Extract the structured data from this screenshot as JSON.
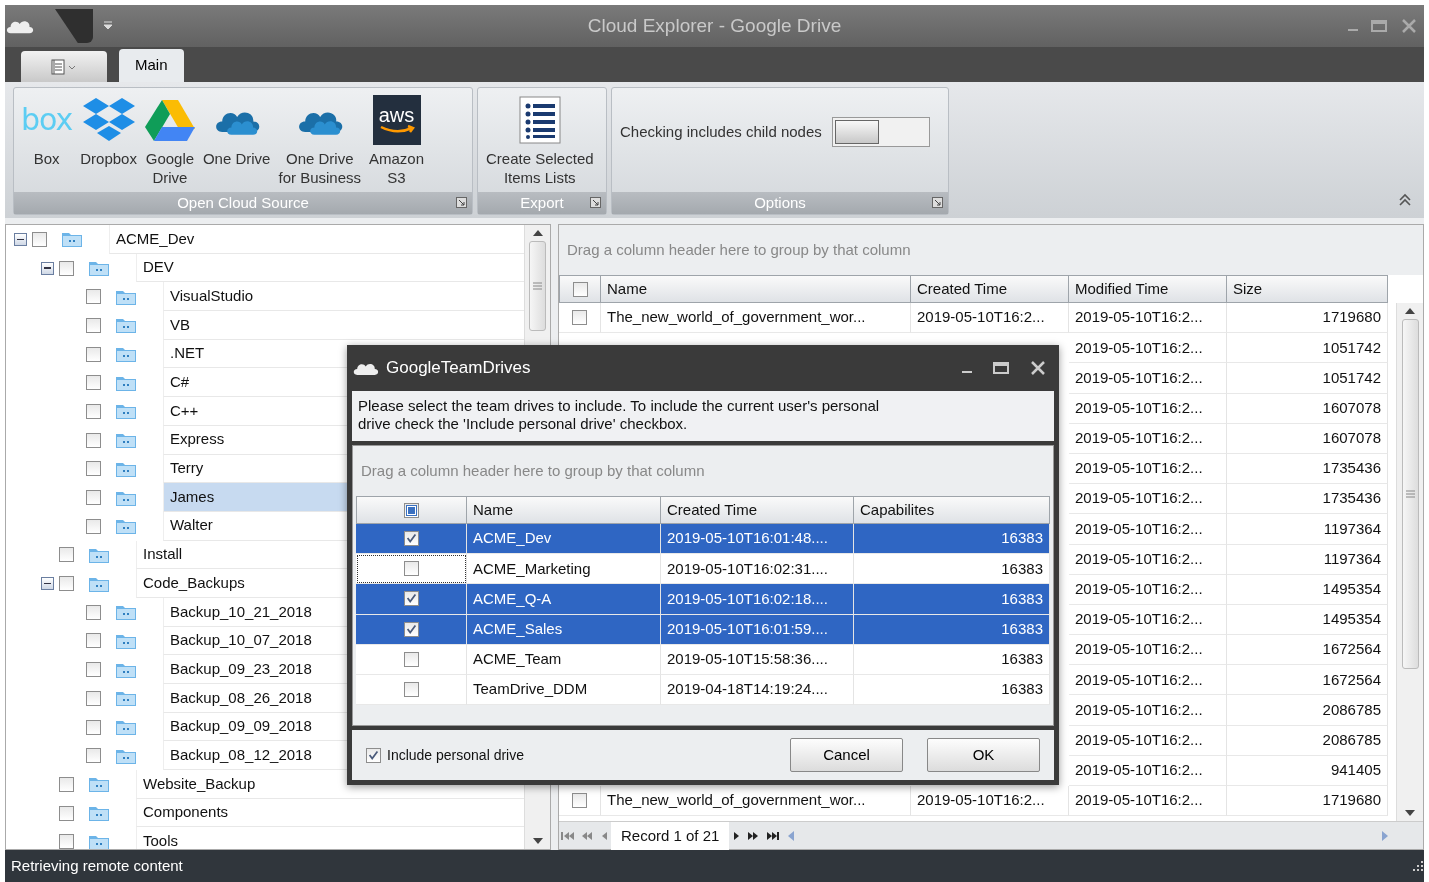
{
  "window": {
    "title": "Cloud Explorer - Google Drive"
  },
  "ribbon": {
    "tabs": [
      {
        "label": "Main",
        "selected": true
      }
    ],
    "groups": [
      {
        "label": "Open Cloud Source",
        "items": [
          {
            "kind": "box",
            "label": "Box",
            "logo_text": "box"
          },
          {
            "kind": "dropbox",
            "label": "Dropbox"
          },
          {
            "kind": "gdrive",
            "label": "Google\nDrive"
          },
          {
            "kind": "cloud",
            "label": "One Drive"
          },
          {
            "kind": "cloud",
            "label": "One Drive\nfor Business"
          },
          {
            "kind": "aws",
            "label": "Amazon\nS3",
            "logo_text": "aws"
          }
        ]
      },
      {
        "label": "Export",
        "items": [
          {
            "kind": "list",
            "label": "Create Selected\nItems Lists"
          }
        ]
      },
      {
        "label": "Options",
        "items": [
          {
            "kind": "toggle",
            "label": "Checking includes child nodes",
            "on": false
          }
        ]
      }
    ]
  },
  "tree": {
    "items": [
      {
        "label": "ACME_Dev",
        "checked": false,
        "selected": false,
        "expanded": true,
        "children": [
          {
            "label": "DEV",
            "checked": false,
            "selected": false,
            "expanded": true,
            "children": [
              {
                "label": "VisualStudio",
                "checked": false,
                "selected": false
              },
              {
                "label": "VB",
                "checked": false,
                "selected": false
              },
              {
                "label": ".NET",
                "checked": false,
                "selected": false
              },
              {
                "label": "C#",
                "checked": false,
                "selected": false
              },
              {
                "label": "C++",
                "checked": false,
                "selected": false
              },
              {
                "label": "Express",
                "checked": false,
                "selected": false
              },
              {
                "label": "Terry",
                "checked": false,
                "selected": false
              },
              {
                "label": "James",
                "checked": false,
                "selected": true
              },
              {
                "label": "Walter",
                "checked": false,
                "selected": false
              }
            ]
          },
          {
            "label": "Install",
            "checked": false,
            "selected": false
          },
          {
            "label": "Code_Backups",
            "checked": false,
            "selected": false,
            "expanded": true,
            "children": [
              {
                "label": "Backup_10_21_2018",
                "checked": false,
                "selected": false
              },
              {
                "label": "Backup_10_07_2018",
                "checked": false,
                "selected": false
              },
              {
                "label": "Backup_09_23_2018",
                "checked": false,
                "selected": false
              },
              {
                "label": "Backup_08_26_2018",
                "checked": false,
                "selected": false
              },
              {
                "label": "Backup_09_09_2018",
                "checked": false,
                "selected": false
              },
              {
                "label": "Backup_08_12_2018",
                "checked": false,
                "selected": false
              }
            ]
          },
          {
            "label": "Website_Backup",
            "checked": false,
            "selected": false
          },
          {
            "label": "Components",
            "checked": false,
            "selected": false
          },
          {
            "label": "Tools",
            "checked": false,
            "selected": false
          }
        ]
      }
    ]
  },
  "grid": {
    "group_hint": "Drag a column header here to group by that column",
    "header_checked": false,
    "columns": [
      "Name",
      "Created Time",
      "Modified Time",
      "Size"
    ],
    "rows": [
      {
        "checked": false,
        "name": "The_new_world_of_government_wor...",
        "created": "2019-05-10T16:2...",
        "modified": "2019-05-10T16:2...",
        "size": "1719680"
      },
      {
        "modified": "2019-05-10T16:2...",
        "size": "1051742"
      },
      {
        "modified": "2019-05-10T16:2...",
        "size": "1051742"
      },
      {
        "modified": "2019-05-10T16:2...",
        "size": "1607078"
      },
      {
        "modified": "2019-05-10T16:2...",
        "size": "1607078"
      },
      {
        "modified": "2019-05-10T16:2...",
        "size": "1735436"
      },
      {
        "modified": "2019-05-10T16:2...",
        "size": "1735436"
      },
      {
        "modified": "2019-05-10T16:2...",
        "size": "1197364"
      },
      {
        "modified": "2019-05-10T16:2...",
        "size": "1197364"
      },
      {
        "modified": "2019-05-10T16:2...",
        "size": "1495354"
      },
      {
        "modified": "2019-05-10T16:2...",
        "size": "1495354"
      },
      {
        "modified": "2019-05-10T16:2...",
        "size": "1672564"
      },
      {
        "modified": "2019-05-10T16:2...",
        "size": "1672564"
      },
      {
        "modified": "2019-05-10T16:2...",
        "size": "2086785"
      },
      {
        "modified": "2019-05-10T16:2...",
        "size": "2086785"
      },
      {
        "modified": "2019-05-10T16:2...",
        "size": "941405"
      },
      {
        "checked": false,
        "name": "The_new_world_of_government_wor...",
        "created": "2019-05-10T16:2...",
        "modified": "2019-05-10T16:2...",
        "size": "1719680"
      }
    ],
    "navigator": "Record 1 of 21"
  },
  "dialog": {
    "title": "GoogleTeamDrives",
    "message": "Please select the team drives to include. To include the current user's personal\ndrive check the 'Include personal drive' checkbox.",
    "group_hint": "Drag a column header here to group by that column",
    "header_indeterminate": true,
    "columns": [
      "Name",
      "Created Time",
      "Capabilites"
    ],
    "rows": [
      {
        "name": "ACME_Dev",
        "created": "2019-05-10T16:01:48....",
        "capabilities": "16383",
        "checked": true,
        "selected": true,
        "focused": false
      },
      {
        "name": "ACME_Marketing",
        "created": "2019-05-10T16:02:31....",
        "capabilities": "16383",
        "checked": false,
        "selected": false,
        "focused": true
      },
      {
        "name": "ACME_Q-A",
        "created": "2019-05-10T16:02:18....",
        "capabilities": "16383",
        "checked": true,
        "selected": true,
        "focused": false
      },
      {
        "name": "ACME_Sales",
        "created": "2019-05-10T16:01:59....",
        "capabilities": "16383",
        "checked": true,
        "selected": true,
        "focused": false
      },
      {
        "name": "ACME_Team",
        "created": "2019-05-10T15:58:36....",
        "capabilities": "16383",
        "checked": false,
        "selected": false,
        "focused": false
      },
      {
        "name": "TeamDrive_DDM",
        "created": "2019-04-18T14:19:24....",
        "capabilities": "16383",
        "checked": false,
        "selected": false,
        "focused": false
      }
    ],
    "include_personal": {
      "label": "Include personal drive",
      "checked": true
    },
    "buttons": [
      "Cancel",
      "OK"
    ]
  },
  "status_bar": "Retrieving remote content"
}
